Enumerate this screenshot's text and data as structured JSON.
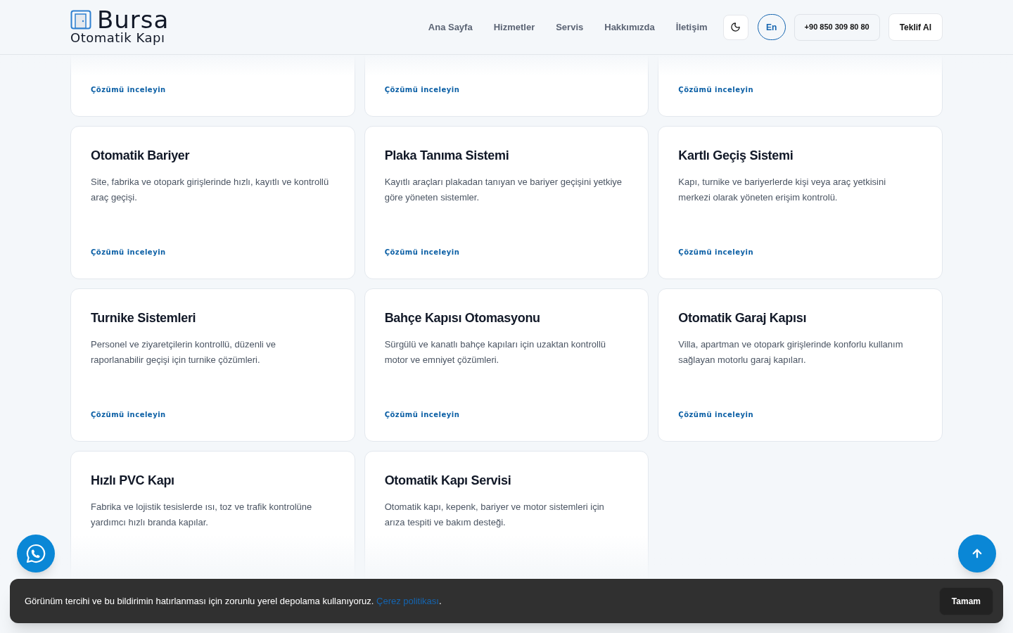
{
  "header": {
    "logo": {
      "title": "Bursa",
      "subtitle": "Otomatik Kapı"
    },
    "nav": [
      {
        "label": "Ana Sayfa"
      },
      {
        "label": "Hizmetler"
      },
      {
        "label": "Servis"
      },
      {
        "label": "Hakkımızda"
      },
      {
        "label": "İletişim"
      }
    ],
    "language": "En",
    "phone": "+90 850 309 80 80",
    "cta": "Teklif Al"
  },
  "cards": [
    {
      "link": "Çözümü inceleyin"
    },
    {
      "link": "Çözümü inceleyin"
    },
    {
      "link": "Çözümü inceleyin"
    },
    {
      "title": "Otomatik Bariyer",
      "description": "Site, fabrika ve otopark girişlerinde hızlı, kayıtlı ve kontrollü araç geçişi.",
      "link": "Çözümü inceleyin"
    },
    {
      "title": "Plaka Tanıma Sistemi",
      "description": "Kayıtlı araçları plakadan tanıyan ve bariyer geçişini yetkiye göre yöneten sistemler.",
      "link": "Çözümü inceleyin"
    },
    {
      "title": "Kartlı Geçiş Sistemi",
      "description": "Kapı, turnike ve bariyerlerde kişi veya araç yetkisini merkezi olarak yöneten erişim kontrolü.",
      "link": "Çözümü inceleyin"
    },
    {
      "title": "Turnike Sistemleri",
      "description": "Personel ve ziyaretçilerin kontrollü, düzenli ve raporlanabilir geçişi için turnike çözümleri.",
      "link": "Çözümü inceleyin"
    },
    {
      "title": "Bahçe Kapısı Otomasyonu",
      "description": "Sürgülü ve kanatlı bahçe kapıları için uzaktan kontrollü motor ve emniyet çözümleri.",
      "link": "Çözümü inceleyin"
    },
    {
      "title": "Otomatik Garaj Kapısı",
      "description": "Villa, apartman ve otopark girişlerinde konforlu kullanım sağlayan motorlu garaj kapıları.",
      "link": "Çözümü inceleyin"
    },
    {
      "title": "Hızlı PVC Kapı",
      "description": "Fabrika ve lojistik tesislerde ısı, toz ve trafik kontrolüne yardımcı hızlı branda kapılar."
    },
    {
      "title": "Otomatik Kapı Servisi",
      "description": "Otomatik kapı, kepenk, bariyer ve motor sistemleri için arıza tespiti ve bakım desteği."
    }
  ],
  "cookie": {
    "text": "Görünüm tercihi ve bu bildirimin hatırlanması için zorunlu yerel depolama kullanıyoruz.",
    "link": "Çerez politikası",
    "end": ".",
    "button": "Tamam"
  }
}
